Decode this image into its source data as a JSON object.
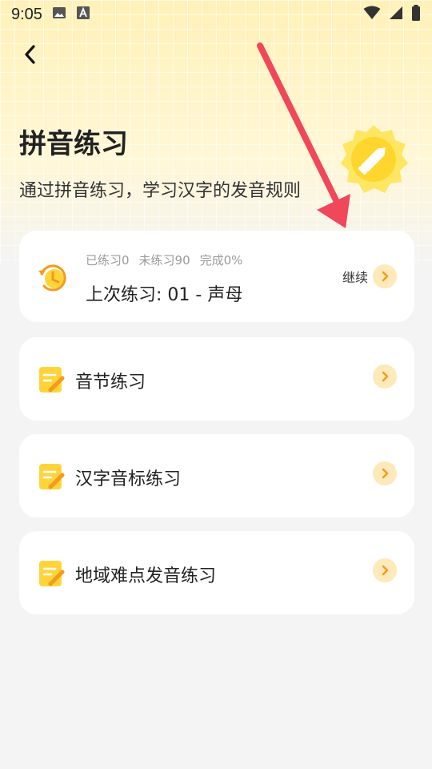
{
  "status_bar": {
    "time": "9:05",
    "icons": [
      "image-icon",
      "font-icon",
      "wifi-icon",
      "signal-icon",
      "battery-icon"
    ]
  },
  "header": {
    "back_icon": "chevron-left-icon",
    "title": "拼音练习",
    "subtitle": "通过拼音练习，学习汉字的发音规则",
    "badge_icon": "pencil-badge-icon"
  },
  "progress_card": {
    "icon": "history-clock-icon",
    "stats": {
      "practiced": "已练习0",
      "unpracticed": "未练习90",
      "completion": "完成0%"
    },
    "last_practice": "上次练习: 01 - 声母",
    "continue_label": "继续"
  },
  "items": [
    {
      "label": "音节练习",
      "icon": "note-edit-icon"
    },
    {
      "label": "汉字音标练习",
      "icon": "note-edit-icon"
    },
    {
      "label": "地域难点发音练习",
      "icon": "note-edit-icon"
    }
  ],
  "colors": {
    "accent_yellow": "#ffd43a",
    "accent_orange": "#f59a1b",
    "chevron_bg": "#fde9b9",
    "annotation_arrow": "#f0475a"
  }
}
